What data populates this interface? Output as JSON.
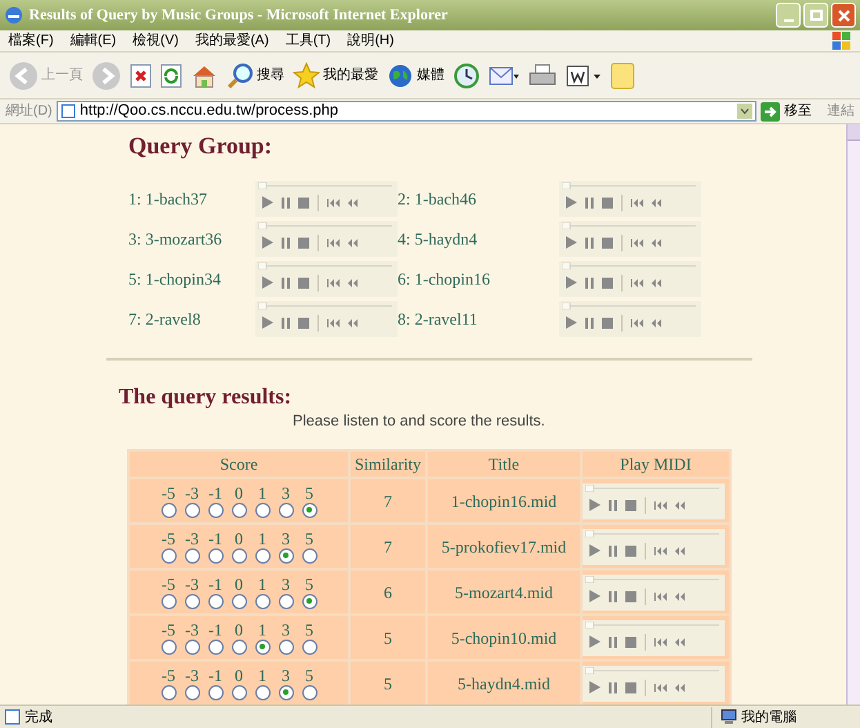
{
  "window": {
    "title": "Results of Query by Music Groups - Microsoft Internet Explorer"
  },
  "menu": [
    "檔案(F)",
    "編輯(E)",
    "檢視(V)",
    "我的最愛(A)",
    "工具(T)",
    "說明(H)"
  ],
  "toolbar": [
    {
      "kind": "back",
      "label": "上一頁"
    },
    {
      "kind": "forward"
    },
    {
      "kind": "stop"
    },
    {
      "kind": "refresh"
    },
    {
      "kind": "home"
    },
    {
      "kind": "search",
      "label": "搜尋"
    },
    {
      "kind": "favorites",
      "label": "我的最愛"
    },
    {
      "kind": "media",
      "label": "媒體"
    },
    {
      "kind": "history"
    },
    {
      "kind": "mail"
    },
    {
      "kind": "print"
    },
    {
      "kind": "edit"
    },
    {
      "kind": "note"
    }
  ],
  "address": {
    "label": "網址(D)",
    "url": "http://Qoo.cs.nccu.edu.tw/process.php",
    "go": "移至",
    "links": "連結"
  },
  "group": {
    "heading": "Query Group:",
    "items": [
      {
        "label": "1: 1-bach37",
        "level": 0
      },
      {
        "label": "2: 1-bach46",
        "level": 0
      },
      {
        "label": "3: 3-mozart36",
        "level": 0
      },
      {
        "label": "4: 5-haydn4",
        "level": 0
      },
      {
        "label": "5: 1-chopin34",
        "level": 0
      },
      {
        "label": "6: 1-chopin16",
        "level": 0
      },
      {
        "label": "7: 2-ravel8",
        "level": 0
      },
      {
        "label": "8: 2-ravel11",
        "level": 0
      }
    ]
  },
  "results": {
    "heading": "The query results:",
    "instruction": "Please listen to and score the results.",
    "columns": [
      "Score",
      "Similarity",
      "Title",
      "Play MIDI"
    ],
    "rows": [
      {
        "scores": [
          {
            "label": "-5",
            "selected": false
          },
          {
            "label": "-3",
            "selected": false
          },
          {
            "label": "-1",
            "selected": false
          },
          {
            "label": "0",
            "selected": false
          },
          {
            "label": "1",
            "selected": false
          },
          {
            "label": "3",
            "selected": false
          },
          {
            "label": "5",
            "selected": true
          }
        ],
        "similarity": "7",
        "title": "1-chopin16.mid",
        "level": 0
      },
      {
        "scores": [
          {
            "label": "-5",
            "selected": false
          },
          {
            "label": "-3",
            "selected": false
          },
          {
            "label": "-1",
            "selected": false
          },
          {
            "label": "0",
            "selected": false
          },
          {
            "label": "1",
            "selected": false
          },
          {
            "label": "3",
            "selected": true
          },
          {
            "label": "5",
            "selected": false
          }
        ],
        "similarity": "7",
        "title": "5-prokofiev17.mid",
        "level": 0
      },
      {
        "scores": [
          {
            "label": "-5",
            "selected": false
          },
          {
            "label": "-3",
            "selected": false
          },
          {
            "label": "-1",
            "selected": false
          },
          {
            "label": "0",
            "selected": false
          },
          {
            "label": "1",
            "selected": false
          },
          {
            "label": "3",
            "selected": false
          },
          {
            "label": "5",
            "selected": true
          }
        ],
        "similarity": "6",
        "title": "5-mozart4.mid",
        "level": 0
      },
      {
        "scores": [
          {
            "label": "-5",
            "selected": false
          },
          {
            "label": "-3",
            "selected": false
          },
          {
            "label": "-1",
            "selected": false
          },
          {
            "label": "0",
            "selected": false
          },
          {
            "label": "1",
            "selected": true
          },
          {
            "label": "3",
            "selected": false
          },
          {
            "label": "5",
            "selected": false
          }
        ],
        "similarity": "5",
        "title": "5-chopin10.mid",
        "level": 0
      },
      {
        "scores": [
          {
            "label": "-5",
            "selected": false
          },
          {
            "label": "-3",
            "selected": false
          },
          {
            "label": "-1",
            "selected": false
          },
          {
            "label": "0",
            "selected": false
          },
          {
            "label": "1",
            "selected": false
          },
          {
            "label": "3",
            "selected": true
          },
          {
            "label": "5",
            "selected": false
          }
        ],
        "similarity": "5",
        "title": "5-haydn4.mid",
        "level": 0
      }
    ]
  },
  "status_bar": {
    "text": "完成",
    "zone": "我的電腦"
  }
}
